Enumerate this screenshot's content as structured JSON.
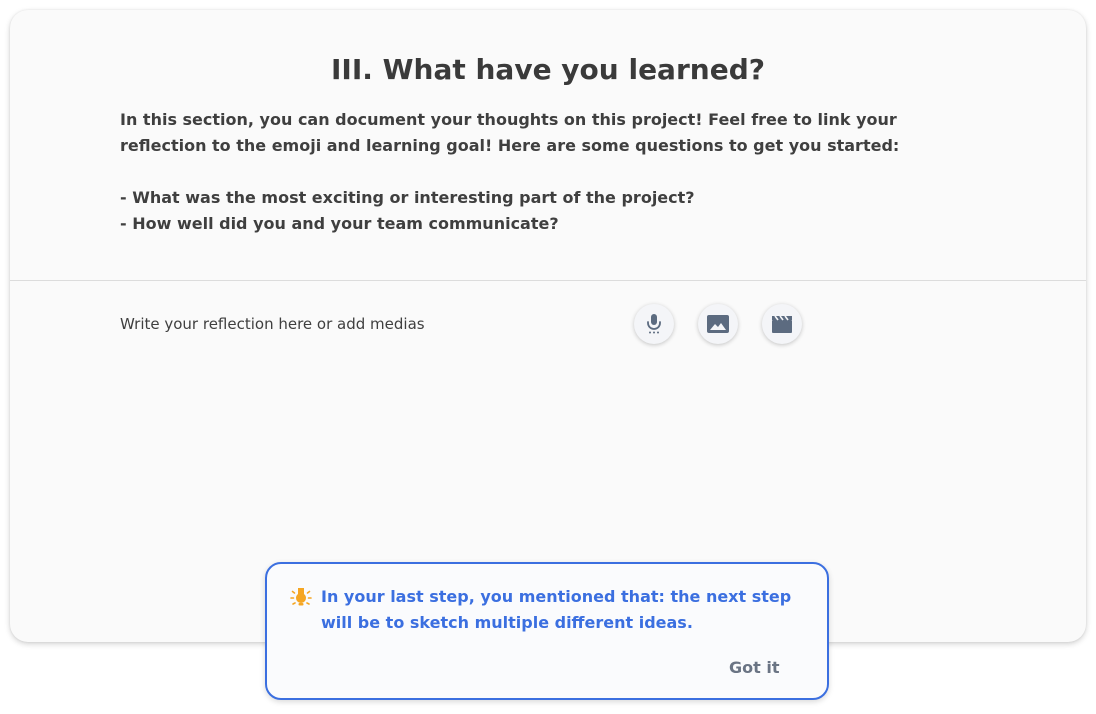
{
  "section": {
    "title": "III. What have you learned?",
    "intro": "In this section, you can document your thoughts on this project! Feel free to link your reflection to the emoji and learning goal! Here are some questions to get you started:",
    "questions": [
      "-  What was the most exciting or interesting part of the project?",
      "-  How well did you and your team communicate?"
    ]
  },
  "editor": {
    "placeholder": "Write your reflection here or add medias",
    "media_buttons": [
      {
        "icon": "microphone-icon"
      },
      {
        "icon": "image-icon"
      },
      {
        "icon": "video-icon"
      }
    ]
  },
  "tip": {
    "icon": "lightbulb-icon",
    "text": "In your last step, you mentioned that: the next step will be to sketch multiple different ideas.",
    "button_label": "Got it"
  },
  "colors": {
    "accent": "#3b6fe0",
    "icon_gray": "#5c6b80",
    "lightbulb": "#f5a623"
  }
}
